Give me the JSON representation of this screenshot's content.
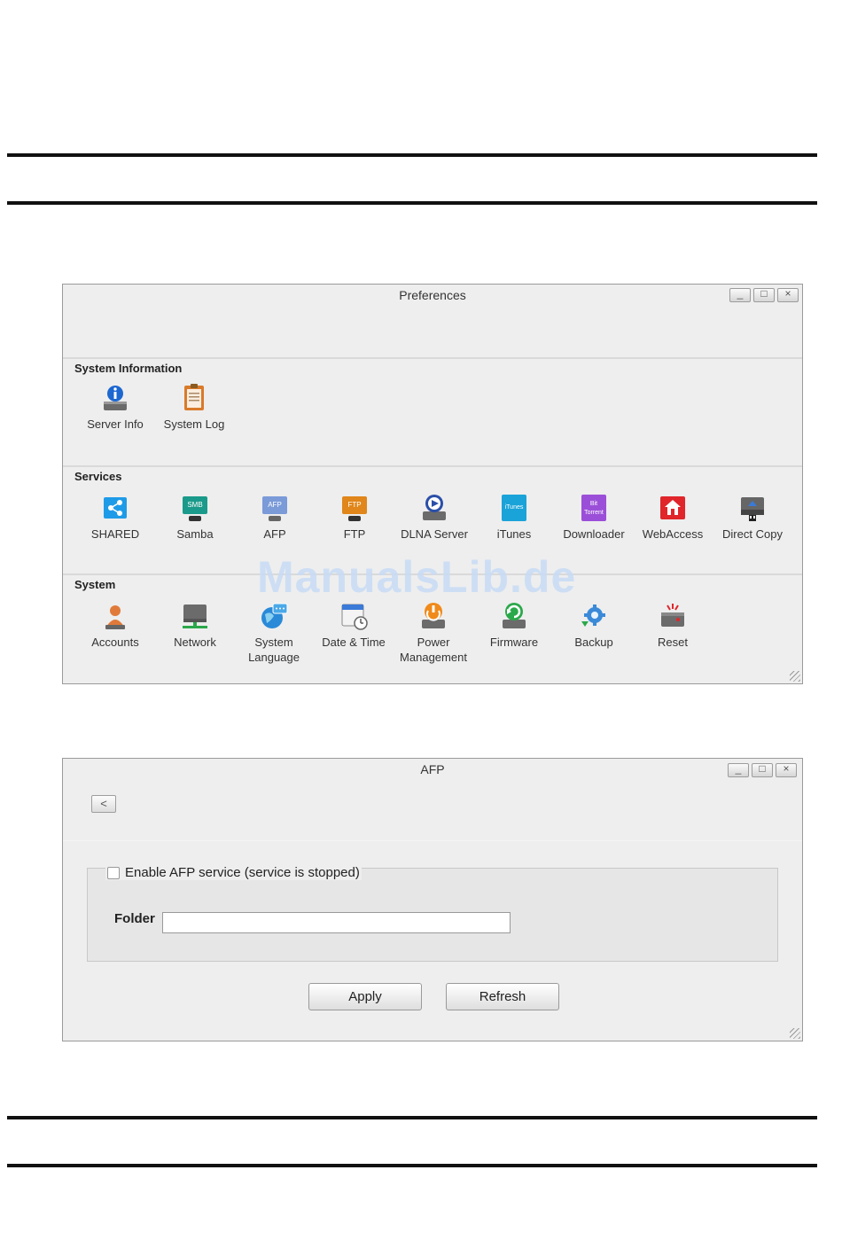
{
  "watermark": "ManualsLib.de",
  "preferences": {
    "title": "Preferences",
    "controls": [
      "_",
      "□",
      "×"
    ],
    "sections": [
      {
        "title": "System Information",
        "items": [
          {
            "label": "Server Info",
            "icon": "server-info-icon"
          },
          {
            "label": "System Log",
            "icon": "system-log-icon"
          }
        ]
      },
      {
        "title": "Services",
        "items": [
          {
            "label": "SHARED",
            "icon": "shared-icon"
          },
          {
            "label": "Samba",
            "icon": "samba-icon",
            "badge": "SMB"
          },
          {
            "label": "AFP",
            "icon": "afp-icon",
            "badge": "AFP"
          },
          {
            "label": "FTP",
            "icon": "ftp-icon",
            "badge": "FTP"
          },
          {
            "label": "DLNA Server",
            "icon": "dlna-server-icon"
          },
          {
            "label": "iTunes",
            "icon": "itunes-icon",
            "badge": "iTunes"
          },
          {
            "label": "Downloader",
            "icon": "downloader-icon",
            "badge": "Bit Torrent"
          },
          {
            "label": "WebAccess",
            "icon": "webaccess-icon"
          },
          {
            "label": "Direct Copy",
            "icon": "direct-copy-icon"
          }
        ]
      },
      {
        "title": "System",
        "items": [
          {
            "label": "Accounts",
            "icon": "accounts-icon"
          },
          {
            "label": "Network",
            "icon": "network-icon"
          },
          {
            "label": "System Language",
            "icon": "system-language-icon"
          },
          {
            "label": "Date & Time",
            "icon": "date-time-icon"
          },
          {
            "label": "Power Management",
            "icon": "power-management-icon"
          },
          {
            "label": "Firmware",
            "icon": "firmware-icon"
          },
          {
            "label": "Backup",
            "icon": "backup-icon"
          },
          {
            "label": "Reset",
            "icon": "reset-icon"
          }
        ]
      }
    ]
  },
  "afp": {
    "title": "AFP",
    "controls": [
      "_",
      "□",
      "×"
    ],
    "back_label": "<",
    "enable_label": "Enable AFP service (service is stopped)",
    "enabled": false,
    "folder_label": "Folder",
    "folder_value": "",
    "apply_label": "Apply",
    "refresh_label": "Refresh"
  },
  "colors": {
    "shared": "#1e9be8",
    "samba": "#1a9a8a",
    "afp": "#7a9ad8",
    "ftp": "#e0861a",
    "itunes": "#1aa3d8",
    "downloader": "#9b4fd8",
    "webaccess": "#e0252b"
  }
}
